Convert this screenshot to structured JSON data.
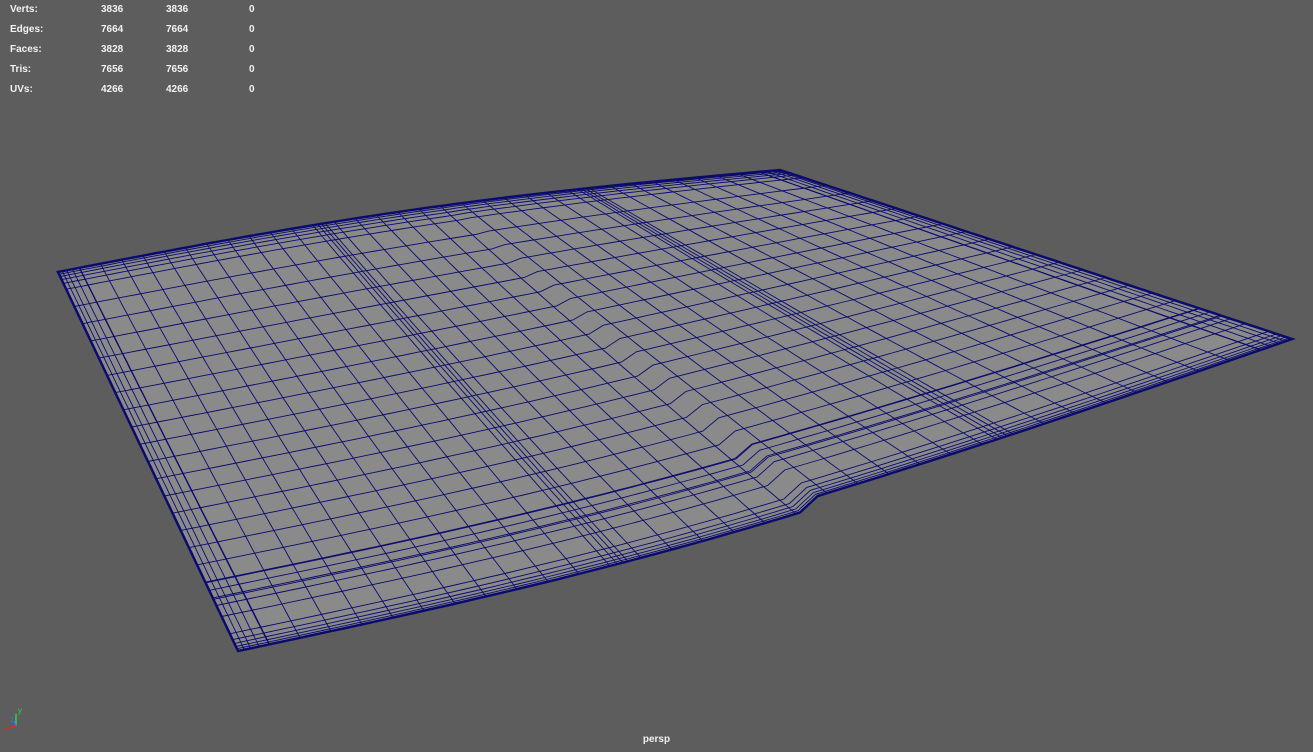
{
  "hud": {
    "rows": [
      {
        "label": "Verts:",
        "c1": "3836",
        "c2": "3836",
        "c3": "0"
      },
      {
        "label": "Edges:",
        "c1": "7664",
        "c2": "7664",
        "c3": "0"
      },
      {
        "label": "Faces:",
        "c1": "3828",
        "c2": "3828",
        "c3": "0"
      },
      {
        "label": "Tris:",
        "c1": "7656",
        "c2": "7656",
        "c3": "0"
      },
      {
        "label": "UVs:",
        "c1": "4266",
        "c2": "4266",
        "c3": "0"
      }
    ]
  },
  "viewport": {
    "camera": "persp",
    "background_color": "#5d5d5d",
    "mesh_fill_color": "#8a8a8a",
    "wire_color": "#0b0b6e"
  },
  "axis_gizmo": {
    "y_label": "y",
    "z_label": "z",
    "x_label": "x"
  }
}
